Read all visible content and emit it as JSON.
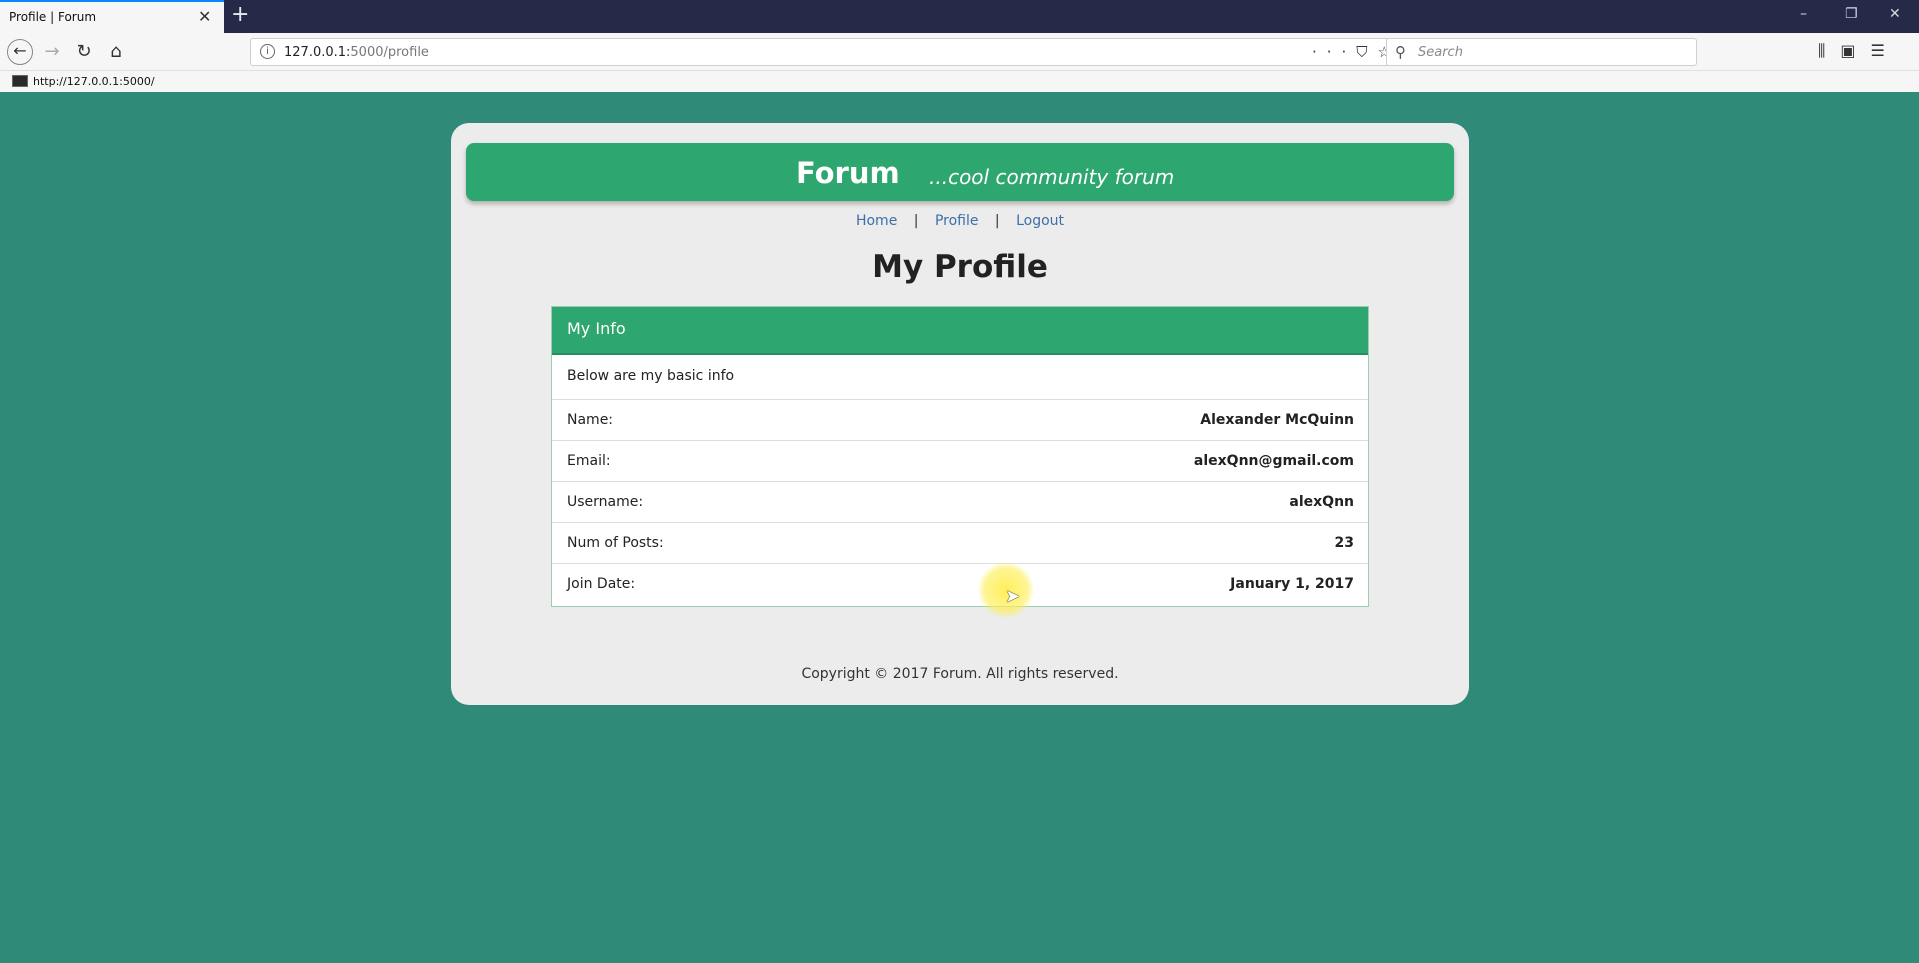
{
  "browser": {
    "tab_title": "Profile | Forum",
    "tab_close": "✕",
    "new_tab": "+",
    "url_host": "127.0.0.1:",
    "url_path": "5000/profile",
    "search_placeholder": "Search",
    "status_url": "http://127.0.0.1:5000/",
    "window_controls": [
      "–",
      "❐",
      "✕"
    ]
  },
  "site": {
    "brand": "Forum",
    "tagline": "...cool community forum",
    "nav": [
      "Home",
      "Profile",
      "Logout"
    ],
    "separator": "|"
  },
  "page": {
    "title": "My Profile",
    "panel_title": "My Info",
    "panel_description": "Below are my basic info",
    "fields": [
      {
        "label": "Name:",
        "value": "Alexander McQuinn"
      },
      {
        "label": "Email:",
        "value": "alexQnn@gmail.com"
      },
      {
        "label": "Username:",
        "value": "alexQnn"
      },
      {
        "label": "Num of Posts:",
        "value": "23"
      },
      {
        "label": "Join Date:",
        "value": "January 1, 2017"
      }
    ],
    "footer": "Copyright © 2017 Forum. All rights reserved."
  },
  "colors": {
    "page_background": "#2f8a77",
    "header_green": "#2ea66f",
    "link_blue": "#3d6fa6"
  }
}
